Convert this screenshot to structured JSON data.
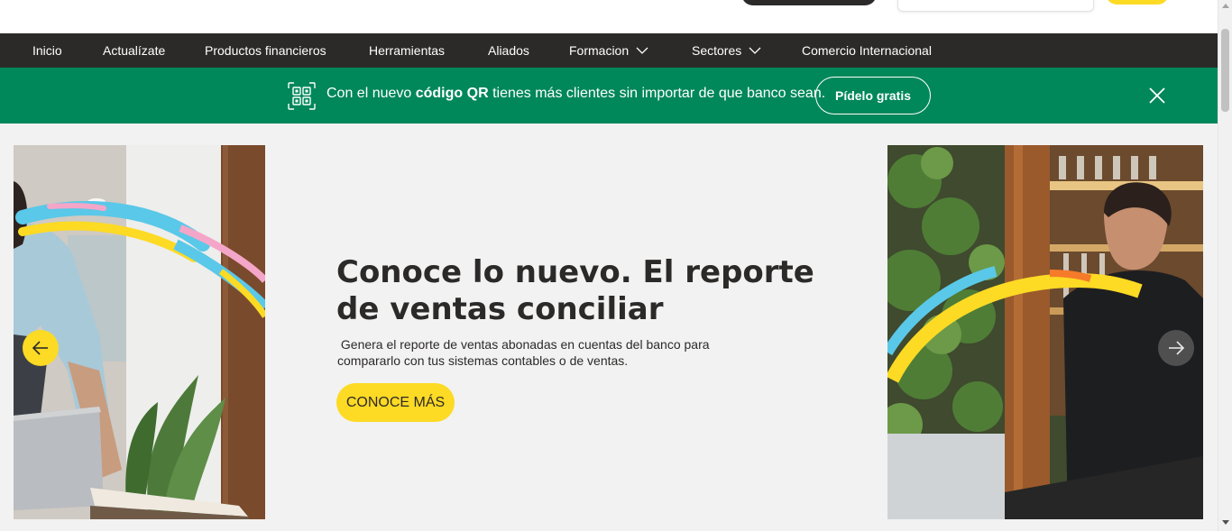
{
  "nav": {
    "items": [
      {
        "label": "Inicio",
        "has_dropdown": false
      },
      {
        "label": "Actualízate",
        "has_dropdown": false
      },
      {
        "label": "Productos financieros",
        "has_dropdown": false
      },
      {
        "label": "Herramientas",
        "has_dropdown": false
      },
      {
        "label": "Aliados",
        "has_dropdown": false
      },
      {
        "label": "Formacion",
        "has_dropdown": true
      },
      {
        "label": "Sectores",
        "has_dropdown": true
      },
      {
        "label": "Comercio Internacional",
        "has_dropdown": false
      }
    ]
  },
  "banner": {
    "text_before": "Con el nuevo ",
    "text_bold": "código QR",
    "text_after": " tienes más clientes sin importar de que banco sean.",
    "button_label": "Pídelo gratis",
    "icon": "qr-code-icon",
    "close_icon": "close-icon"
  },
  "hero": {
    "headline": "Conoce lo nuevo. El reporte de ventas conciliar",
    "subtext": " Genera el reporte de ventas abonadas en cuentas del banco para\ncompararlo con tus sistemas contables o de ventas.",
    "cta_label": "CONOCE MÁS"
  },
  "carousel": {
    "prev_icon": "arrow-left-icon",
    "next_icon": "arrow-right-icon"
  },
  "colors": {
    "nav_bg": "#2c2a29",
    "banner_bg": "#00875a",
    "accent_yellow": "#fdda24",
    "text_dark": "#2c2a29",
    "page_bg": "#f2f2f2"
  }
}
